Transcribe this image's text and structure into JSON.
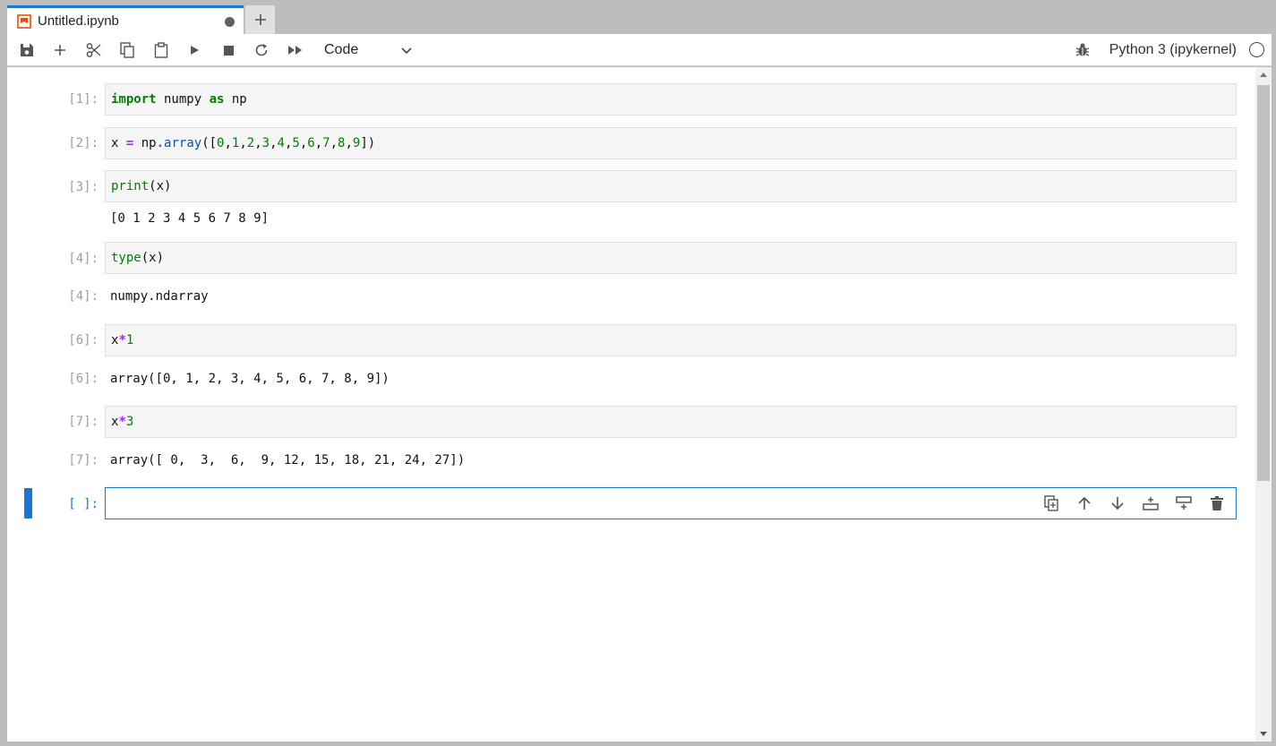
{
  "tab": {
    "title": "Untitled.ipynb",
    "new_tab_label": "+"
  },
  "toolbar": {
    "buttons": [
      "save-icon",
      "plus-icon",
      "cut-icon",
      "copy-icon",
      "paste-icon",
      "run-icon",
      "stop-icon",
      "restart-icon",
      "fast-forward-icon"
    ],
    "cell_type": "Code",
    "kernel_name": "Python 3 (ipykernel)"
  },
  "cells": [
    {
      "prompt": "[1]:",
      "code": "import numpy as np"
    },
    {
      "prompt": "[2]:",
      "code": "x = np.array([0,1,2,3,4,5,6,7,8,9])"
    },
    {
      "prompt": "[3]:",
      "code": "print(x)",
      "output": "[0 1 2 3 4 5 6 7 8 9]"
    },
    {
      "prompt": "[4]:",
      "code": "type(x)",
      "out_prompt": "[4]:",
      "output": "numpy.ndarray"
    },
    {
      "prompt": "[6]:",
      "code": "x*1",
      "out_prompt": "[6]:",
      "output": "array([0, 1, 2, 3, 4, 5, 6, 7, 8, 9])"
    },
    {
      "prompt": "[7]:",
      "code": "x*3",
      "out_prompt": "[7]:",
      "output": "array([ 0,  3,  6,  9, 12, 15, 18, 21, 24, 27])"
    },
    {
      "prompt": "[ ]:",
      "code": ""
    }
  ],
  "colors": {
    "accent": "#1976d2",
    "keyword": "#008000",
    "operator": "#aa22ff"
  }
}
